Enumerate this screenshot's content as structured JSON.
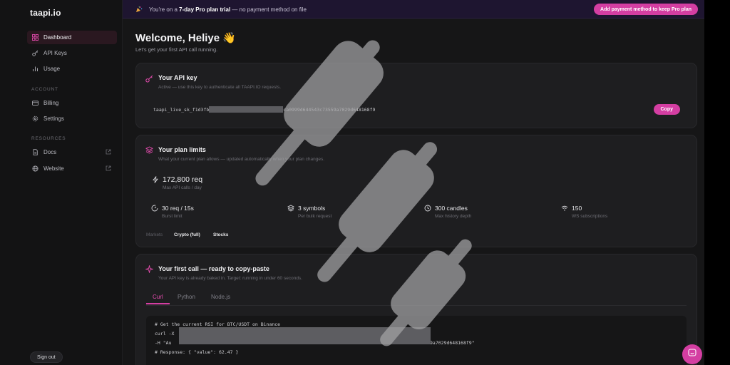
{
  "app": {
    "brand": "taapi.io"
  },
  "sidebar": {
    "items": [
      {
        "label": "Dashboard",
        "icon": "grid-icon",
        "active": true
      },
      {
        "label": "API Keys",
        "icon": "key-icon"
      },
      {
        "label": "Usage",
        "icon": "bar-chart-icon"
      }
    ],
    "account_label": "ACCOUNT",
    "account_items": [
      {
        "label": "Billing",
        "icon": "card-icon"
      },
      {
        "label": "Settings",
        "icon": "gear-icon"
      }
    ],
    "resources_label": "RESOURCES",
    "resources_items": [
      {
        "label": "Docs",
        "icon": "doc-icon",
        "external": true
      },
      {
        "label": "Website",
        "icon": "globe-icon",
        "external": true
      }
    ],
    "signout_label": "Sign out"
  },
  "banner": {
    "prefix": "You're on a ",
    "highlight": "7-day Pro plan trial",
    "suffix": " — no payment method on file",
    "button_label": "Add payment method to keep Pro plan"
  },
  "main": {
    "welcome": "Welcome, Heliye 👋",
    "subtitle": "Let's get your first API call running."
  },
  "api_key_card": {
    "title": "Your API key",
    "subtitle": "Active — use this key to authenticate all TAAPI.IO requests.",
    "key_prefix": "taapi_live_sk_f1d3fb",
    "key_suffix": "ca0999d644543c73559a7029d648168f9",
    "copy_label": "Copy"
  },
  "plan_card": {
    "title": "Your plan limits",
    "subtitle": "What your current plan allows — updated automatically when your plan changes.",
    "primary_value": "172,800 req",
    "primary_label": "Max API calls / day",
    "stats": [
      {
        "value": "30 req / 15s",
        "label": "Burst limit",
        "icon": "gauge-icon"
      },
      {
        "value": "3 symbols",
        "label": "Per bulk request",
        "icon": "layers-icon"
      },
      {
        "value": "300 candles",
        "label": "Max history depth",
        "icon": "clock-icon"
      },
      {
        "value": "150",
        "label": "WS subscriptions",
        "icon": "wifi-icon"
      }
    ],
    "markets_label": "Markets",
    "markets": [
      "Crypto (full)",
      "Stocks"
    ]
  },
  "first_call_card": {
    "title": "Your first call — ready to copy-paste",
    "subtitle": "Your API key is already baked in. Target: running in under 60 seconds.",
    "tabs": [
      "Curl",
      "Python",
      "Node.js"
    ],
    "active_tab": "Curl",
    "code_lines": [
      "# Get the current RSI for BTC/USDT on Binance",
      "curl -X",
      "  -H \"Au",
      "# Response: { \"value\": 62.47 }"
    ],
    "code_line3_tail": "9a7029d648168f9\""
  },
  "colors": {
    "accent": "#d43ea2",
    "banner_bg": "#1e1530",
    "card_bg": "#1e1e20"
  }
}
